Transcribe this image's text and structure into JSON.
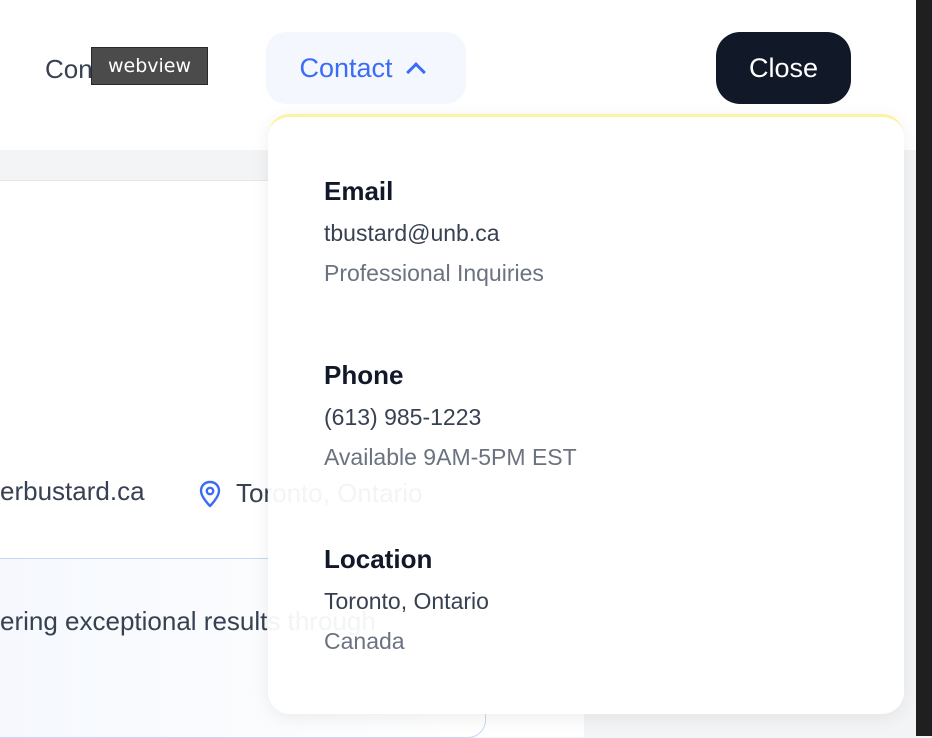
{
  "header": {
    "nav_partial_label": "Con",
    "tooltip_text": "webview",
    "contact_label": "Contact",
    "close_label": "Close"
  },
  "background": {
    "website_partial": "erbustard.ca",
    "location_text": "Toronto, Ontario",
    "tagline_partial": "ering exceptional results through"
  },
  "contact_menu": {
    "email": {
      "title": "Email",
      "value": "tbustard@unb.ca",
      "note": "Professional Inquiries"
    },
    "phone": {
      "title": "Phone",
      "value": "(613) 985-1223",
      "note": "Available 9AM-5PM EST"
    },
    "location": {
      "title": "Location",
      "value": "Toronto, Ontario",
      "note": "Canada"
    }
  },
  "colors": {
    "accent": "#3b6cf6",
    "close_bg": "#111827",
    "dropdown_border": "#fbf3a0"
  },
  "icons": {
    "nav_chevron": "chevron-down-icon",
    "contact_chevron": "chevron-up-icon",
    "location_pin": "map-pin-icon"
  }
}
